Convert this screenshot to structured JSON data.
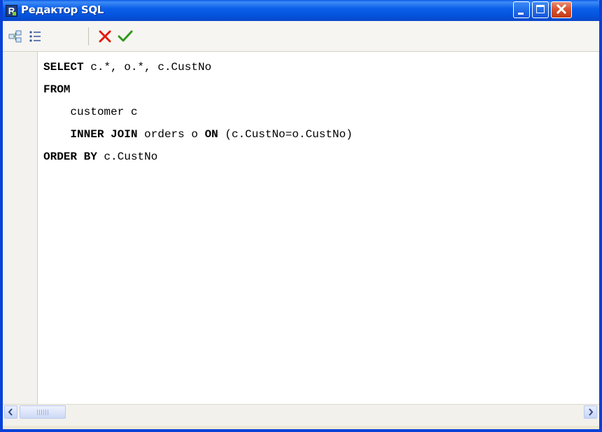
{
  "window": {
    "title": "Редактор SQL",
    "app_icon_letter": "R",
    "controls": [
      "minimize",
      "maximize",
      "close"
    ]
  },
  "toolbar": {
    "buttons": [
      {
        "name": "query-builder",
        "icon": "schema-icon"
      },
      {
        "name": "field-list",
        "icon": "list-icon"
      },
      {
        "name": "cancel",
        "icon": "red-x-icon",
        "color": "#e31b0e"
      },
      {
        "name": "ok",
        "icon": "green-check-icon",
        "color": "#2f9a1c"
      }
    ]
  },
  "editor": {
    "lines": [
      {
        "indent": "",
        "kw1": "SELECT",
        "t1": " c.*, o.*, c.CustNo",
        "kw2": "",
        "t2": "",
        "kw3": "",
        "t3": ""
      },
      {
        "indent": "",
        "kw1": "FROM",
        "t1": "",
        "kw2": "",
        "t2": "",
        "kw3": "",
        "t3": ""
      },
      {
        "indent": "    ",
        "kw1": "",
        "t1": "customer c",
        "kw2": "",
        "t2": "",
        "kw3": "",
        "t3": ""
      },
      {
        "indent": "    ",
        "kw1": "INNER JOIN",
        "t1": " orders o ",
        "kw2": "ON",
        "t2": " (c.CustNo=o.CustNo)",
        "kw3": "",
        "t3": ""
      },
      {
        "indent": "",
        "kw1": "ORDER BY",
        "t1": " c.CustNo",
        "kw2": "",
        "t2": "",
        "kw3": "",
        "t3": ""
      }
    ]
  },
  "colors": {
    "titlebar": "#0453dc",
    "frame": "#0841d8",
    "cancel": "#e31b0e",
    "ok": "#2f9a1c"
  }
}
